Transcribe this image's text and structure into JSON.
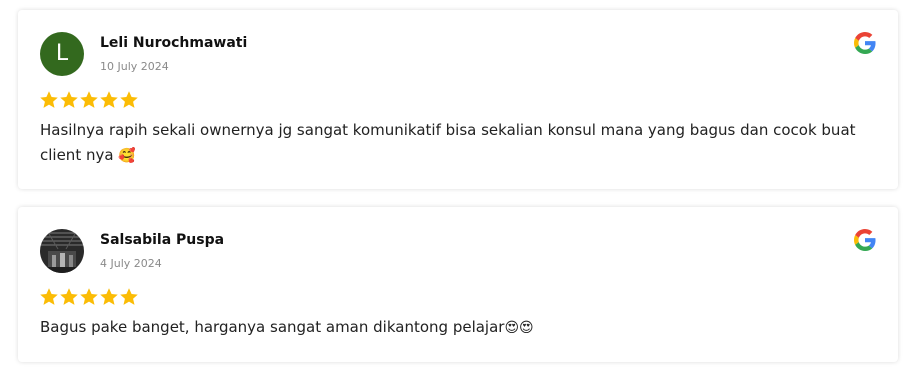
{
  "reviews": [
    {
      "author": "Leli Nurochmawati",
      "initial": "L",
      "date": "10 July 2024",
      "rating": 5,
      "text": "Hasilnya rapih sekali ownernya jg sangat komunikatif bisa sekalian konsul mana yang bagus dan cocok buat client nya",
      "emoji": "🥰",
      "avatar_color": "#33691e"
    },
    {
      "author": "Salsabila Puspa",
      "date": "4 July 2024",
      "rating": 5,
      "text": "Bagus pake banget, harganya sangat aman dikantong pelajar",
      "emoji": "😍😍"
    }
  ],
  "icons": {
    "source": "google-icon",
    "star": "star-icon"
  },
  "colors": {
    "star": "#fbbc05",
    "google_blue": "#4285f4",
    "google_red": "#ea4335",
    "google_yellow": "#fbbc05",
    "google_green": "#34a853"
  }
}
